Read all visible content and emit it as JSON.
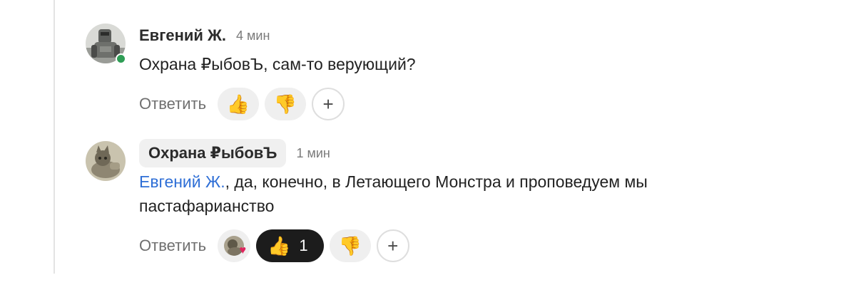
{
  "comments": [
    {
      "author": "Евгений Ж.",
      "time": "4 мин",
      "text": "Охрана ₽ыбовЪ, сам-то верующий?",
      "reply_label": "Ответить",
      "reactions": [
        {
          "emoji": "👍",
          "count": ""
        },
        {
          "emoji": "👎",
          "count": ""
        }
      ],
      "add_reaction": "+"
    },
    {
      "author": "Охрана ₽ыбовЪ",
      "time": "1 мин",
      "mention": "Евгений Ж.",
      "text": ", да, конечно, в Летающего Монстра и проповедуем мы пастафарианство",
      "reply_label": "Ответить",
      "reactions": [
        {
          "emoji": "👍",
          "count": "1"
        },
        {
          "emoji": "👎",
          "count": ""
        }
      ],
      "add_reaction": "+"
    }
  ],
  "colors": {
    "online": "#2e9d55",
    "mention": "#2f6fd6",
    "active_reaction_bg": "#1c1c1c"
  }
}
